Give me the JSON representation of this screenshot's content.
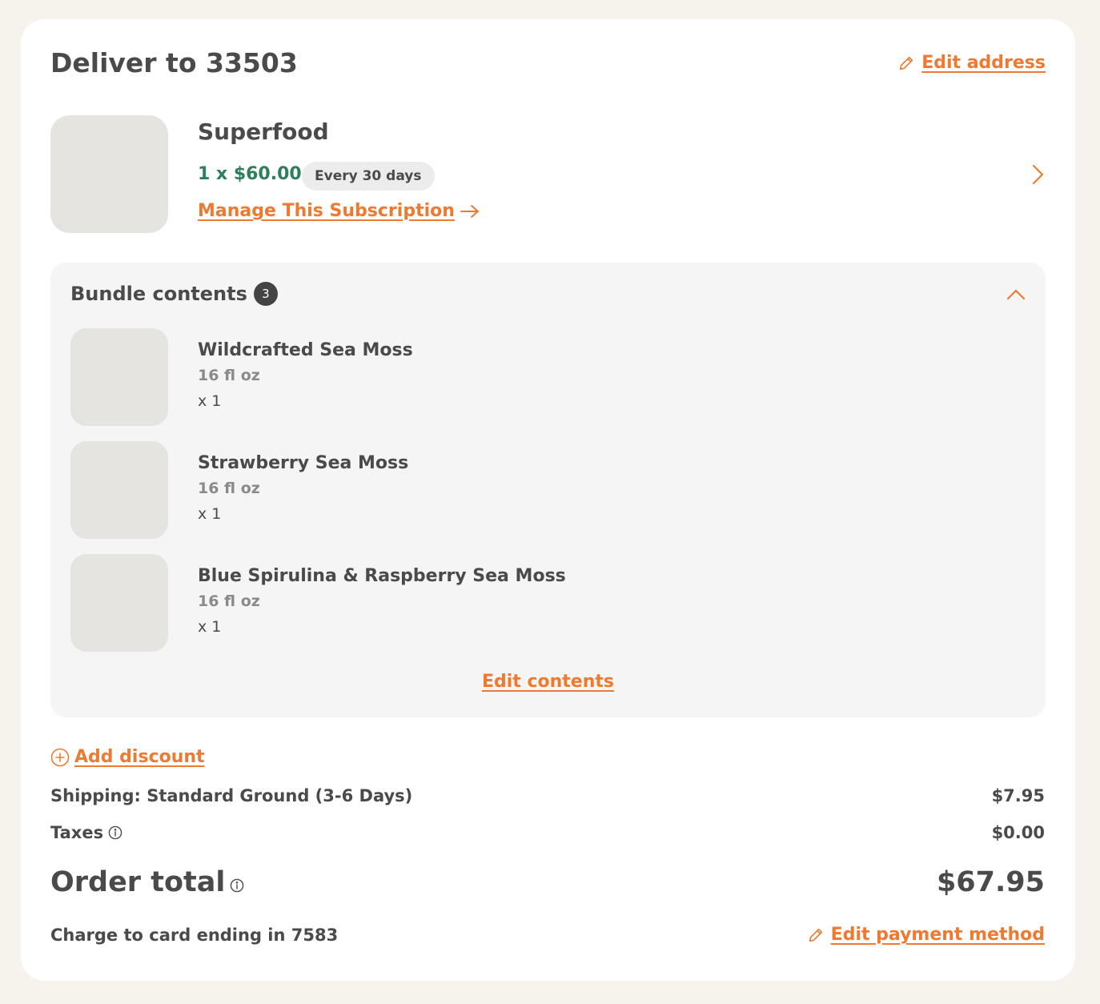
{
  "header": {
    "title": "Deliver to 33503",
    "edit_address_label": "Edit address"
  },
  "product": {
    "name": "Superfood",
    "price": "1 x $60.00",
    "frequency": "Every 30 days",
    "manage_label": "Manage This Subscription"
  },
  "bundle": {
    "title": "Bundle contents",
    "count": "3",
    "items": [
      {
        "name": "Wildcrafted Sea Moss",
        "size": "16 fl oz",
        "qty": "x 1"
      },
      {
        "name": "Strawberry Sea Moss",
        "size": "16 fl oz",
        "qty": "x 1"
      },
      {
        "name": "Blue Spirulina & Raspberry Sea Moss",
        "size": "16 fl oz",
        "qty": "x 1"
      }
    ],
    "edit_label": "Edit contents"
  },
  "summary": {
    "add_discount_label": "Add discount",
    "shipping_label": "Shipping: Standard Ground (3-6 Days)",
    "shipping_value": "$7.95",
    "taxes_label": "Taxes",
    "taxes_value": "$0.00",
    "total_label": "Order total",
    "total_value": "$67.95",
    "charge_label": "Charge to card ending in 7583",
    "edit_payment_label": "Edit payment method"
  },
  "icons": {
    "edit": "pencil-icon",
    "manage": "arrow-right-icon",
    "expand": "chevron-right-icon",
    "collapse": "chevron-up-icon",
    "discount": "plus-circle-icon",
    "info": "info-icon"
  },
  "colors": {
    "accent": "#ee7a32",
    "price_green": "#2e7d5b",
    "page_bg": "#f6f3ec",
    "bundle_bg": "#f5f5f5"
  }
}
